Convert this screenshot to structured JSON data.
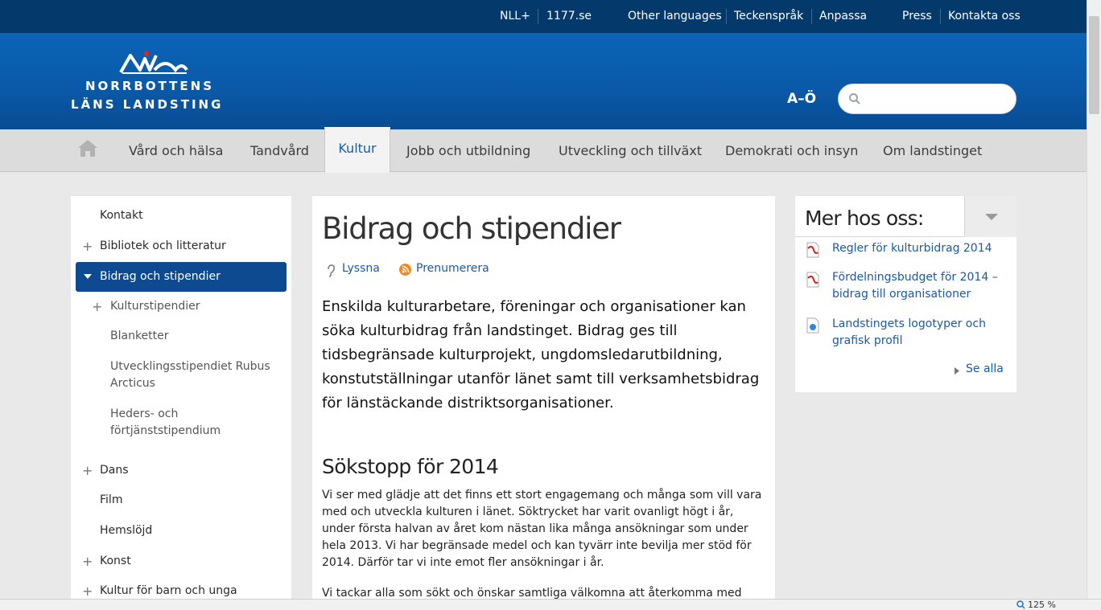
{
  "topbar": {
    "links": [
      "NLL+",
      "1177.se",
      "Other languages",
      "Teckenspråk",
      "Anpassa",
      "Press",
      "Kontakta oss"
    ]
  },
  "header": {
    "logo_line1": "NORRBOTTENS",
    "logo_line2": "LÄNS LANDSTING",
    "az_label": "A–Ö",
    "search_value": "",
    "search_placeholder": ""
  },
  "nav": {
    "items": [
      "Vård och hälsa",
      "Tandvård",
      "Kultur",
      "Jobb och utbildning",
      "Utveckling och tillväxt",
      "Demokrati och insyn",
      "Om landstinget"
    ],
    "active": "Kultur"
  },
  "leftnav": {
    "items": [
      "Kontakt",
      "Bibliotek och litteratur",
      "Bidrag och stipendier",
      "Kulturstipendier",
      "Blanketter",
      "Utvecklingsstipendiet Rubus Arcticus",
      "Heders- och förtjänststipendium",
      "Dans",
      "Film",
      "Hemslöjd",
      "Konst",
      "Kultur för barn och unga"
    ],
    "expand_symbol": "+"
  },
  "main": {
    "title": "Bidrag och stipendier",
    "listen_label": "Lyssna",
    "subscribe_label": "Prenumerera",
    "lead": "Enskilda kulturarbetare, föreningar och organisationer kan söka kulturbidrag från landstinget. Bidrag ges till tidsbegränsade kulturprojekt, ungdomsledarutbildning, konstutställningar utanför länet samt till verksamhetsbidrag för länstäckande distriktsorganisationer.",
    "heading": "Sökstopp för 2014",
    "paragraphs": [
      "Vi ser med glädje att det finns ett stort engagemang och många som vill vara med och utveckla kulturen i länet. Söktrycket har varit ovanligt högt i år, under första halvan av året kom nästan lika många ansökningar som under hela 2013. Vi har begränsade medel och kan tyvärr inte bevilja mer stöd för 2014. Därför tar vi inte emot fler ansökningar i år.",
      "Vi tackar alla som sökt och önskar samtliga välkomna att återkomma med"
    ]
  },
  "sidebar_right": {
    "title": "Mer hos oss:",
    "documents": [
      {
        "label": "Regler för kulturbidrag 2014",
        "icon": "pdf-icon"
      },
      {
        "label": "Fördelningsbudget för 2014 –bidrag till organisationer",
        "icon": "pdf-icon"
      },
      {
        "label": "Landstingets logotyper och grafisk profil",
        "icon": "image-file-icon"
      }
    ],
    "see_all": "Se alla"
  },
  "status": {
    "zoom": "125 %"
  },
  "colors": {
    "topbar": "#043a6b",
    "header": "#0a5aa9",
    "active_leftnav": "#0d4a8f",
    "link": "#1a5aa0"
  }
}
